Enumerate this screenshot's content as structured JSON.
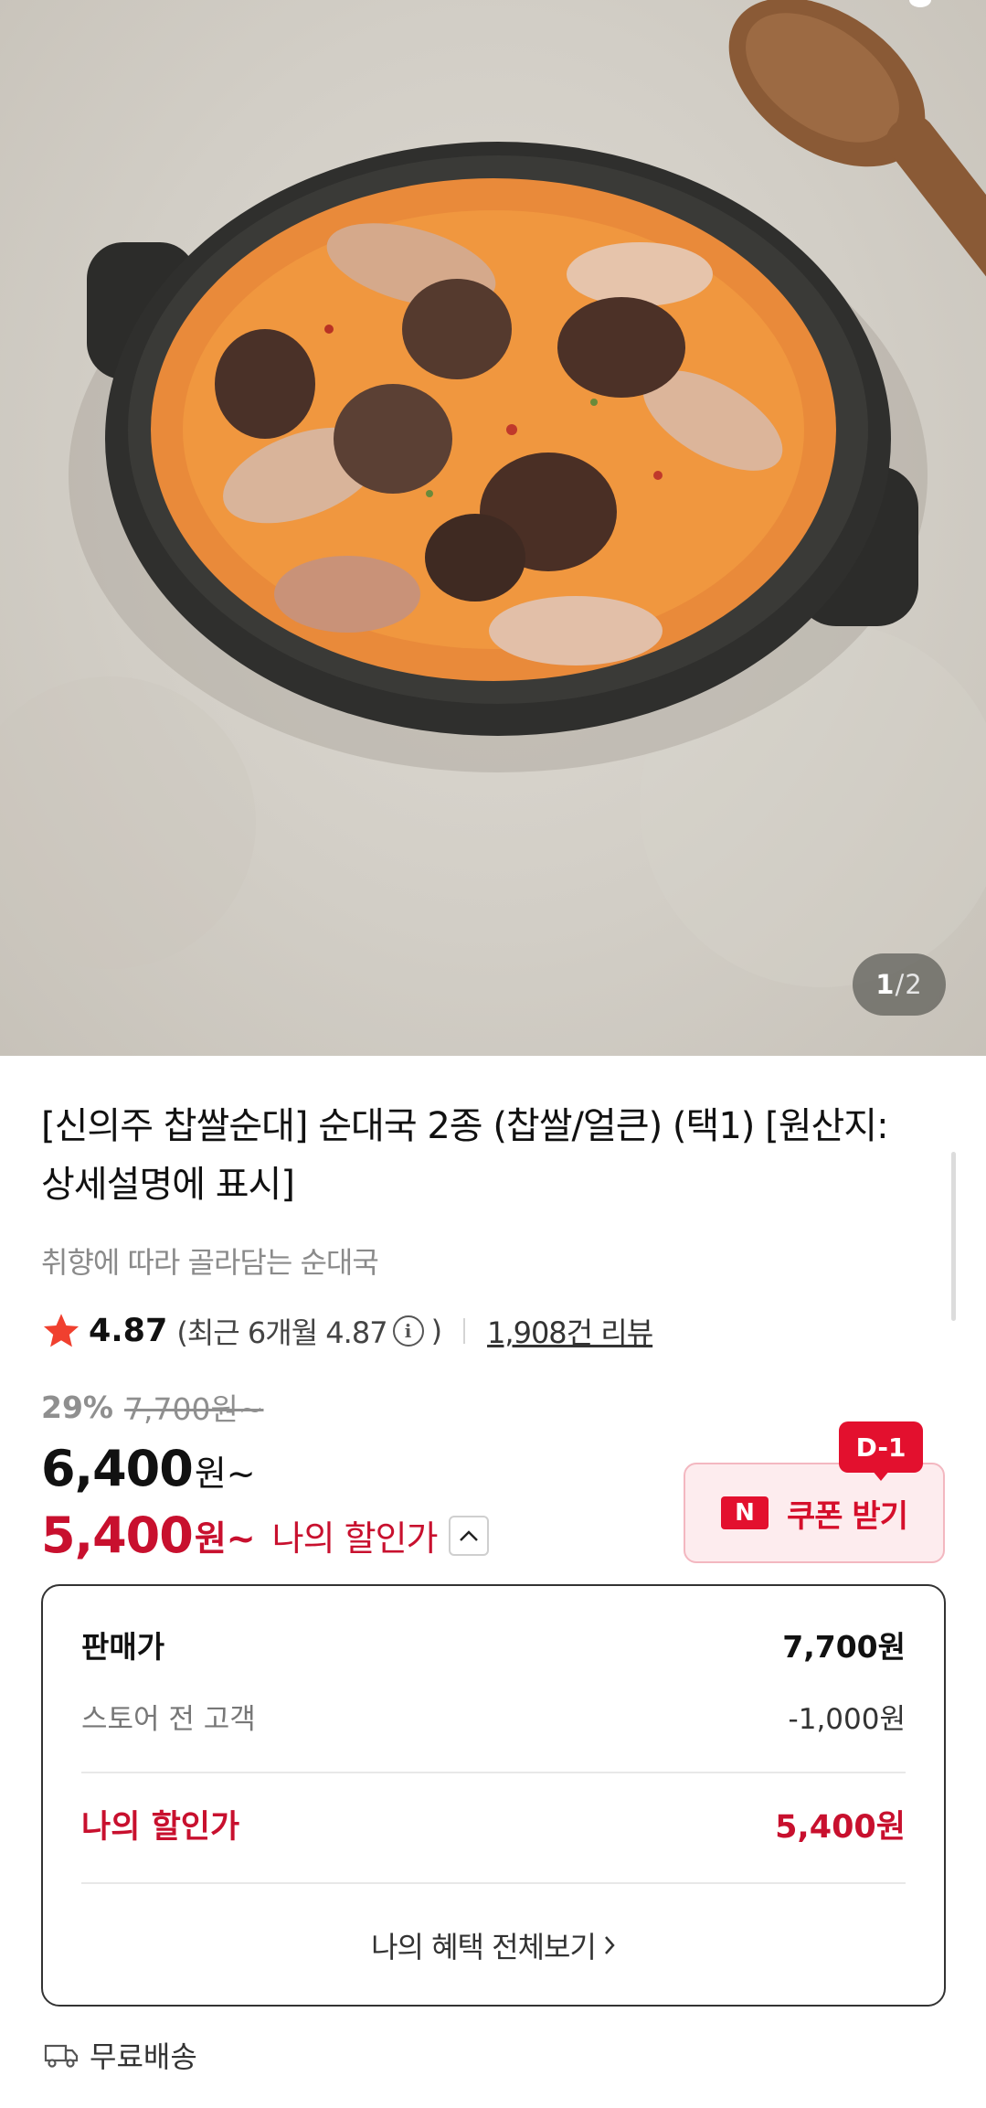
{
  "hero": {
    "current_page": "1",
    "separator": "/",
    "total_pages": "2",
    "image_icon": "soondae-guk-photo"
  },
  "product": {
    "title": "[신의주 찹쌀순대] 순대국 2종 (찹쌀/얼큰) (택1) [원산지: 상세설명에 표시]",
    "subtitle": "취향에 따라 골라담는 순대국"
  },
  "rating": {
    "score": "4.87",
    "recent_text": "(최근 6개월 4.87",
    "recent_close": ")",
    "info_icon": "ⓘ",
    "review_count": "1,908건 리뷰",
    "star_color": "#f0402f"
  },
  "pricing": {
    "discount_rate": "29%",
    "original_price": "7,700원~",
    "sale_price": "6,400",
    "sale_unit": "원~",
    "my_price": "5,400",
    "my_unit": "원~",
    "my_label": "나의 할인가",
    "accent_color": "#c8102e"
  },
  "coupon": {
    "badge": "D-1",
    "n_icon": "N",
    "label": "쿠폰 받기"
  },
  "breakdown": {
    "rows": [
      {
        "label": "판매가",
        "value": "7,700원"
      },
      {
        "label": "스토어 전 고객",
        "value": "-1,000원"
      },
      {
        "label": "나의 할인가",
        "value": "5,400원"
      }
    ],
    "more_link": "나의 혜택 전체보기"
  },
  "shipping": {
    "label": "무료배송",
    "icon": "truck-icon"
  }
}
